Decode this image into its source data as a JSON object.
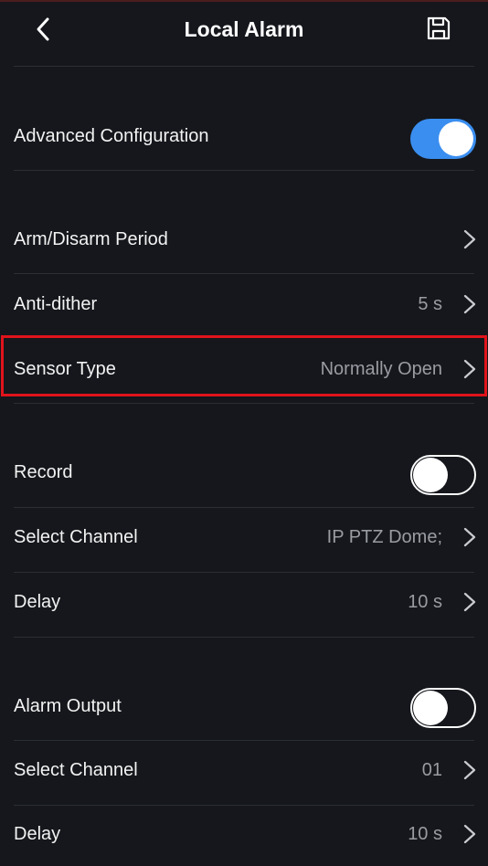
{
  "header": {
    "title": "Local Alarm",
    "back_icon": "chevron-left-icon",
    "save_icon": "floppy-disk-icon"
  },
  "advanced": {
    "label": "Advanced Configuration",
    "enabled": true
  },
  "schedule": {
    "arm_disarm_label": "Arm/Disarm Period",
    "anti_dither_label": "Anti-dither",
    "anti_dither_value": "5 s",
    "sensor_type_label": "Sensor Type",
    "sensor_type_value": "Normally Open"
  },
  "record": {
    "label": "Record",
    "enabled": false,
    "select_channel_label": "Select Channel",
    "select_channel_value": "IP PTZ Dome;",
    "delay_label": "Delay",
    "delay_value": "10 s"
  },
  "alarm_output": {
    "label": "Alarm Output",
    "enabled": false,
    "select_channel_label": "Select Channel",
    "select_channel_value": "01",
    "delay_label": "Delay",
    "delay_value": "10 s"
  },
  "colors": {
    "background": "#15171c",
    "accent": "#3a8ef0",
    "highlight": "#e0131b",
    "secondary_text": "#9a9ca3"
  }
}
